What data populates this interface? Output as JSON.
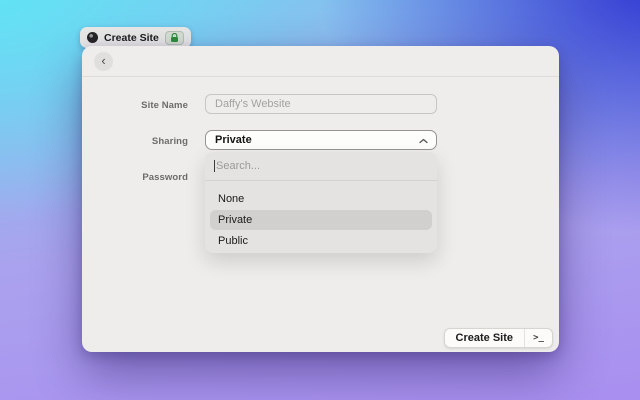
{
  "tab": {
    "title": "Create Site",
    "favicon": "site-favicon",
    "lock": "lock-icon"
  },
  "window": {
    "header": {
      "back_glyph": "‹"
    },
    "form": {
      "site_name": {
        "label": "Site Name",
        "value": "",
        "placeholder": "Daffy's Website"
      },
      "sharing": {
        "label": "Sharing",
        "value": "Private"
      },
      "password": {
        "label": "Password"
      }
    },
    "dropdown": {
      "search_placeholder": "Search...",
      "search_value": "",
      "options": [
        {
          "label": "None"
        },
        {
          "label": "Private"
        },
        {
          "label": "Public"
        }
      ],
      "selected_option": "Private"
    },
    "footer": {
      "create_label": "Create Site",
      "terminal_glyph": ">_"
    }
  },
  "colors": {
    "bg_top_left": "#60e4f5",
    "bg_top_right": "#3237d2",
    "bg_bottom": "#a98ff0",
    "window_bg": "#eeedeb",
    "panel_bg": "#e4e3e1",
    "option_highlight": "#d1d0ce",
    "lock_green": "#2f8f3e"
  }
}
